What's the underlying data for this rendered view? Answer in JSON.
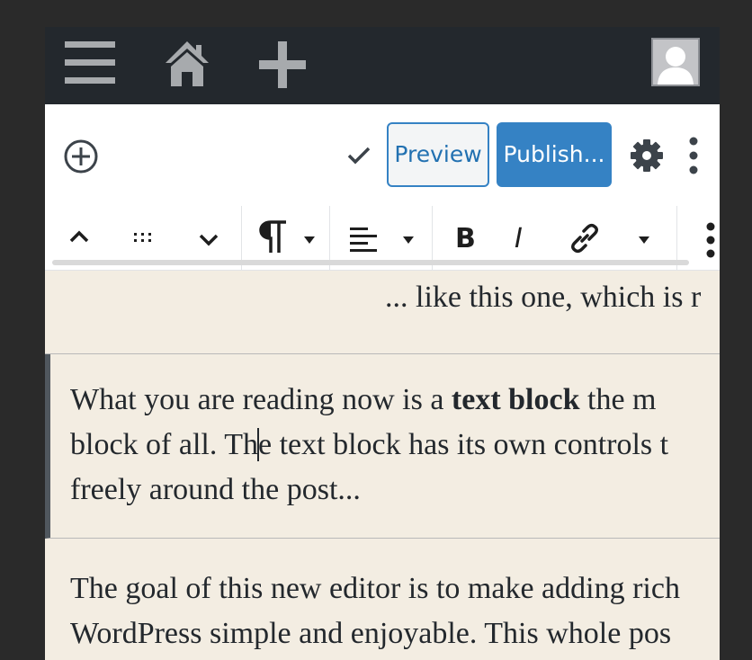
{
  "admin_bar": {
    "menu_icon": "hamburger-menu-icon",
    "home_icon": "home-icon",
    "new_icon": "plus-icon",
    "avatar_icon": "user-avatar-icon"
  },
  "editor_header": {
    "inserter_icon": "plus-circle-icon",
    "saved_icon": "checkmark-icon",
    "preview_label": "Preview",
    "publish_label": "Publish...",
    "settings_icon": "gear-icon",
    "more_icon": "vertical-ellipsis-icon"
  },
  "block_toolbar": {
    "icons": [
      "chevron-up-icon",
      "drag-handle-icon",
      "chevron-down-icon",
      "paragraph-icon",
      "dropdown-arrow-icon",
      "align-left-icon",
      "dropdown-arrow-icon",
      "bold-icon",
      "italic-icon",
      "link-icon",
      "dropdown-arrow-icon",
      "vertical-ellipsis-icon"
    ],
    "bold_label": "B",
    "italic_label": "I"
  },
  "content": {
    "previous_block_text": "... like this one, which is r",
    "active_block": {
      "line1_before": "What you are reading now is a ",
      "line1_bold": "text block",
      "line1_after": " the m",
      "line2_before_caret": "block of all. Th",
      "line2_after_caret": "e text block has its own controls t",
      "line3": "freely around the post..."
    },
    "next_block": {
      "line1": "The goal of this new editor is to make adding rich",
      "line2": "WordPress simple and enjoyable. This whole pos"
    }
  },
  "colors": {
    "admin_bar": "#23282d",
    "accent": "#3582c4",
    "content_bg": "#f3ede2",
    "text": "#23282d"
  }
}
